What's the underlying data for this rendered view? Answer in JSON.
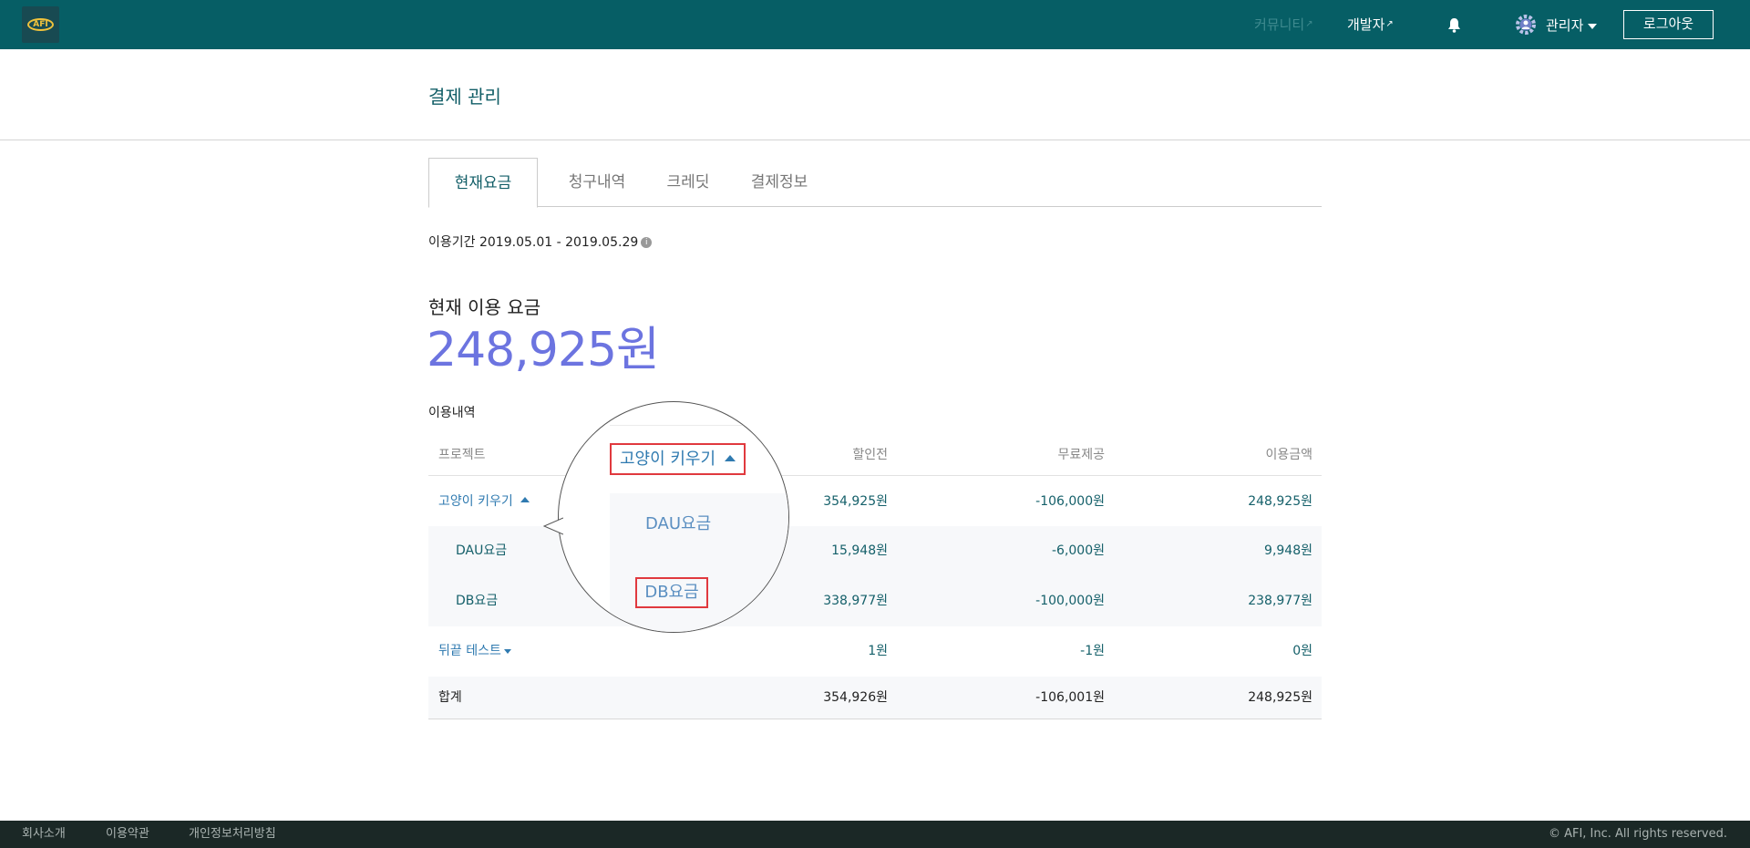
{
  "header": {
    "logo_text": "AFI",
    "community": "커뮤니티",
    "developer": "개발자",
    "admin": "관리자",
    "logout": "로그아웃"
  },
  "page": {
    "title": "결제 관리"
  },
  "tabs": [
    {
      "label": "현재요금",
      "active": true
    },
    {
      "label": "청구내역",
      "active": false
    },
    {
      "label": "크레딧",
      "active": false
    },
    {
      "label": "결제정보",
      "active": false
    }
  ],
  "period": {
    "label": "이용기간",
    "range": "2019.05.01 - 2019.05.29"
  },
  "current": {
    "label": "현재 이용 요금",
    "amount": "248,925원"
  },
  "usage": {
    "label": "이용내역",
    "columns": [
      "프로젝트",
      "할인전",
      "무료제공",
      "이용금액"
    ],
    "rows": [
      {
        "name": "고양이 키우기",
        "before": "354,925원",
        "free": "-106,000원",
        "amount": "248,925원"
      },
      {
        "name": "DAU요금",
        "before": "15,948원",
        "free": "-6,000원",
        "amount": "9,948원"
      },
      {
        "name": "DB요금",
        "before": "338,977원",
        "free": "-100,000원",
        "amount": "238,977원"
      },
      {
        "name": "뒤끝 테스트",
        "before": "1원",
        "free": "-1원",
        "amount": "0원"
      }
    ],
    "total": {
      "name": "합계",
      "before": "354,926원",
      "free": "-106,001원",
      "amount": "248,925원"
    }
  },
  "magnifier": {
    "project": "고양이 키우기",
    "item1": "DAU요금",
    "item2": "DB요금"
  },
  "footer": {
    "links": [
      "회사소개",
      "이용약관",
      "개인정보처리방침"
    ],
    "copyright": "© AFI, Inc. All rights reserved."
  },
  "colors": {
    "topbar": "#065e65",
    "accent": "#6c74e0",
    "highlight": "#e0393e"
  }
}
